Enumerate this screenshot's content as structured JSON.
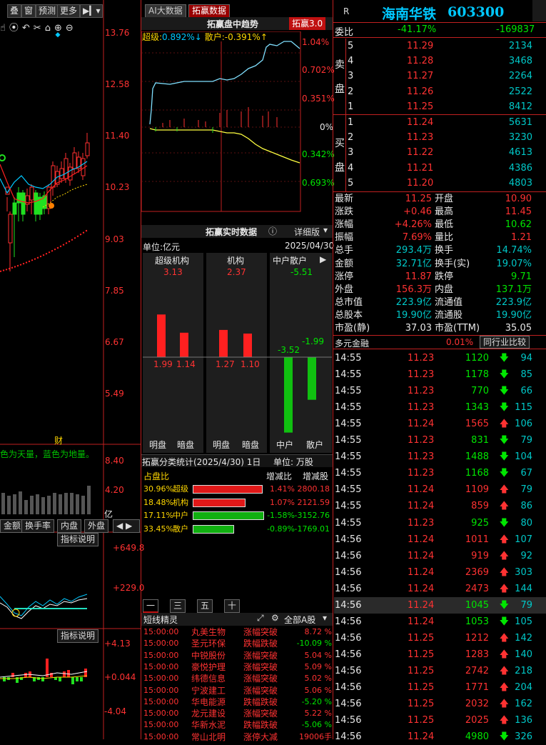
{
  "toolbar": {
    "items": [
      "叠",
      "窗",
      "预测",
      "更多"
    ],
    "tabs": [
      "AI大数据",
      "拓赢数据"
    ]
  },
  "left_chart": {
    "price_axis": [
      "13.76",
      "12.58",
      "11.40",
      "10.23",
      "9.03",
      "7.85",
      "6.67",
      "5.49"
    ],
    "marker": "财",
    "note": "色为天量，蓝色为地量。",
    "vol_axis": [
      "8.40",
      "4.20"
    ],
    "vol_unit": "亿",
    "tabs": [
      "金额",
      "换手率",
      "内盘",
      "外盘"
    ],
    "indicator_btn": "指标说明",
    "ind1_axis": [
      "+649.8",
      "+229.0"
    ],
    "indicator_btn2": "指标说明",
    "ind2_axis": [
      "+4.13",
      "+0.044",
      "-4.04"
    ]
  },
  "trend": {
    "title": "拓赢盘中趋势",
    "badge": "拓赢3.0",
    "super_label": "超级:",
    "super_val": "0.892%↓",
    "retail_label": "散户:",
    "retail_val": "-0.391%↑",
    "axis": [
      "1.04%",
      "0.702%",
      "0.351%",
      "0%",
      "0.342%",
      "0.693%"
    ]
  },
  "realtime": {
    "title": "拓赢实时数据",
    "detail": "详细版",
    "unit": "单位:亿元",
    "date": "2025/04/30",
    "cols": [
      {
        "name": "超级机构",
        "total": "3.13",
        "v1": "1.99",
        "v2": "1.14",
        "l1": "明盘",
        "l2": "暗盘"
      },
      {
        "name": "机构",
        "total": "2.37",
        "v1": "1.27",
        "v2": "1.10",
        "l1": "明盘",
        "l2": "暗盘"
      },
      {
        "name": "中户散户",
        "total": "-5.51",
        "v1": "-3.52",
        "v2": "-1.99",
        "l1": "中户",
        "l2": "散户"
      }
    ]
  },
  "classify": {
    "title": "拓赢分类统计(2025/4/30) 1日",
    "unit": "单位: 万股",
    "headers": [
      "占盘比",
      "增减比",
      "增减股"
    ],
    "rows": [
      {
        "pct": "30.96%",
        "name": "超级",
        "fill": 0.98,
        "ratio": "1.41%",
        "shares": "2800.18",
        "color": "#e01818"
      },
      {
        "pct": "18.48%",
        "name": "机构",
        "fill": 0.74,
        "ratio": "1.07%",
        "shares": "2121.59",
        "color": "#e01818"
      },
      {
        "pct": "17.11%",
        "name": "中户",
        "fill": 1.0,
        "ratio": "-1.58%",
        "shares": "-3152.76",
        "color": "#10b010"
      },
      {
        "pct": "33.45%",
        "name": "散户",
        "fill": 0.58,
        "ratio": "-0.89%",
        "shares": "-1769.01",
        "color": "#10b010"
      }
    ]
  },
  "period_tabs": [
    "一日",
    "三日",
    "五日",
    "十日"
  ],
  "wizard": {
    "title": "短线精灵",
    "filter": "全部A股",
    "rows": [
      {
        "time": "15:00:00",
        "name": "丸美生物",
        "event": "涨幅突破",
        "value": "8.72 %",
        "up": true
      },
      {
        "time": "15:00:00",
        "name": "圣元环保",
        "event": "跌幅跌破",
        "value": "-10.09 %",
        "up": false
      },
      {
        "time": "15:00:00",
        "name": "中锐股份",
        "event": "涨幅突破",
        "value": "5.04 %",
        "up": true
      },
      {
        "time": "15:00:00",
        "name": "豪悦护理",
        "event": "涨幅突破",
        "value": "5.09 %",
        "up": true
      },
      {
        "time": "15:00:00",
        "name": "纬德信息",
        "event": "涨幅突破",
        "value": "5.02 %",
        "up": true
      },
      {
        "time": "15:00:00",
        "name": "宁波建工",
        "event": "涨幅突破",
        "value": "5.06 %",
        "up": true
      },
      {
        "time": "15:00:00",
        "name": "华电能源",
        "event": "跌幅跌破",
        "value": "-5.20 %",
        "up": false
      },
      {
        "time": "15:00:00",
        "name": "龙元建设",
        "event": "涨幅突破",
        "value": "5.22 %",
        "up": true
      },
      {
        "time": "15:00:00",
        "name": "华新水泥",
        "event": "跌幅跌破",
        "value": "-5.06 %",
        "up": false
      },
      {
        "time": "15:00:00",
        "name": "常山北明",
        "event": "涨停大减",
        "value": "19006手",
        "up": true
      }
    ]
  },
  "stock": {
    "r": "R",
    "name": "海南华铁",
    "code": "603300",
    "webi_label": "委比",
    "webi_pct": "-41.17%",
    "webi_val": "-169837"
  },
  "sell": [
    {
      "lvl": "5",
      "price": "11.29",
      "vol": "2134"
    },
    {
      "lvl": "4",
      "price": "11.28",
      "vol": "3468"
    },
    {
      "lvl": "3",
      "price": "11.27",
      "vol": "2264"
    },
    {
      "lvl": "2",
      "price": "11.26",
      "vol": "2522"
    },
    {
      "lvl": "1",
      "price": "11.25",
      "vol": "8412"
    }
  ],
  "sell_label": [
    "卖",
    "盘"
  ],
  "buy": [
    {
      "lvl": "1",
      "price": "11.24",
      "vol": "5631"
    },
    {
      "lvl": "2",
      "price": "11.23",
      "vol": "3230"
    },
    {
      "lvl": "3",
      "price": "11.22",
      "vol": "4613"
    },
    {
      "lvl": "4",
      "price": "11.21",
      "vol": "4386"
    },
    {
      "lvl": "5",
      "price": "11.20",
      "vol": "4803"
    }
  ],
  "buy_label": [
    "买",
    "盘"
  ],
  "stats": [
    {
      "l1": "最新",
      "v1": "11.25",
      "c1": "red",
      "l2": "开盘",
      "v2": "10.90",
      "c2": "red"
    },
    {
      "l1": "涨跌",
      "v1": "+0.46",
      "c1": "red",
      "l2": "最高",
      "v2": "11.45",
      "c2": "red"
    },
    {
      "l1": "涨幅",
      "v1": "+4.26%",
      "c1": "red",
      "l2": "最低",
      "v2": "10.62",
      "c2": "green"
    },
    {
      "l1": "振幅",
      "v1": "7.69%",
      "c1": "red",
      "l2": "量比",
      "v2": "1.21",
      "c2": "red"
    },
    {
      "l1": "总手",
      "v1": "293.4万",
      "c1": "cyan",
      "l2": "换手",
      "v2": "14.74%",
      "c2": "cyan"
    },
    {
      "l1": "金额",
      "v1": "32.71亿",
      "c1": "cyan",
      "l2": "换手(实)",
      "v2": "19.07%",
      "c2": "cyan"
    },
    {
      "l1": "涨停",
      "v1": "11.87",
      "c1": "red",
      "l2": "跌停",
      "v2": "9.71",
      "c2": "green"
    },
    {
      "l1": "外盘",
      "v1": "156.3万",
      "c1": "red",
      "l2": "内盘",
      "v2": "137.1万",
      "c2": "green"
    },
    {
      "l1": "总市值",
      "v1": "223.9亿",
      "c1": "cyan",
      "l2": "流通值",
      "v2": "223.9亿",
      "c2": "cyan"
    },
    {
      "l1": "总股本",
      "v1": "19.90亿",
      "c1": "cyan",
      "l2": "流通股",
      "v2": "19.90亿",
      "c2": "cyan"
    },
    {
      "l1": "市盈(静)",
      "v1": "37.03",
      "c1": "white",
      "l2": "市盈(TTM)",
      "v2": "35.05",
      "c2": "white"
    }
  ],
  "sector": {
    "name": "多元金融",
    "pct": "0.01%",
    "btn": "同行业比较"
  },
  "ticks": [
    {
      "t": "14:55",
      "p": "11.23",
      "v": "1120",
      "d": "down",
      "n": "94"
    },
    {
      "t": "14:55",
      "p": "11.23",
      "v": "1178",
      "d": "down",
      "n": "85"
    },
    {
      "t": "14:55",
      "p": "11.23",
      "v": "770",
      "d": "down",
      "n": "66"
    },
    {
      "t": "14:55",
      "p": "11.23",
      "v": "1343",
      "d": "down",
      "n": "115"
    },
    {
      "t": "14:55",
      "p": "11.24",
      "v": "1565",
      "d": "up",
      "n": "106"
    },
    {
      "t": "14:55",
      "p": "11.23",
      "v": "831",
      "d": "down",
      "n": "79"
    },
    {
      "t": "14:55",
      "p": "11.23",
      "v": "1488",
      "d": "down",
      "n": "104"
    },
    {
      "t": "14:55",
      "p": "11.23",
      "v": "1168",
      "d": "down",
      "n": "67"
    },
    {
      "t": "14:55",
      "p": "11.24",
      "v": "1109",
      "d": "up",
      "n": "79"
    },
    {
      "t": "14:55",
      "p": "11.24",
      "v": "859",
      "d": "up",
      "n": "86"
    },
    {
      "t": "14:55",
      "p": "11.23",
      "v": "925",
      "d": "down",
      "n": "80"
    },
    {
      "t": "14:56",
      "p": "11.24",
      "v": "1011",
      "d": "up",
      "n": "107"
    },
    {
      "t": "14:56",
      "p": "11.24",
      "v": "919",
      "d": "up",
      "n": "92"
    },
    {
      "t": "14:56",
      "p": "11.24",
      "v": "2369",
      "d": "up",
      "n": "303"
    },
    {
      "t": "14:56",
      "p": "11.24",
      "v": "2473",
      "d": "up",
      "n": "144"
    },
    {
      "t": "14:56",
      "p": "11.24",
      "v": "1045",
      "d": "down",
      "n": "79"
    },
    {
      "t": "14:56",
      "p": "11.24",
      "v": "1053",
      "d": "down",
      "n": "105"
    },
    {
      "t": "14:56",
      "p": "11.25",
      "v": "1212",
      "d": "up",
      "n": "142"
    },
    {
      "t": "14:56",
      "p": "11.25",
      "v": "1283",
      "d": "up",
      "n": "140"
    },
    {
      "t": "14:56",
      "p": "11.25",
      "v": "2742",
      "d": "up",
      "n": "218"
    },
    {
      "t": "14:56",
      "p": "11.25",
      "v": "1771",
      "d": "up",
      "n": "204"
    },
    {
      "t": "14:56",
      "p": "11.25",
      "v": "2032",
      "d": "up",
      "n": "162"
    },
    {
      "t": "14:56",
      "p": "11.25",
      "v": "2025",
      "d": "up",
      "n": "136"
    },
    {
      "t": "14:56",
      "p": "11.24",
      "v": "4980",
      "d": "down",
      "n": "326"
    }
  ]
}
